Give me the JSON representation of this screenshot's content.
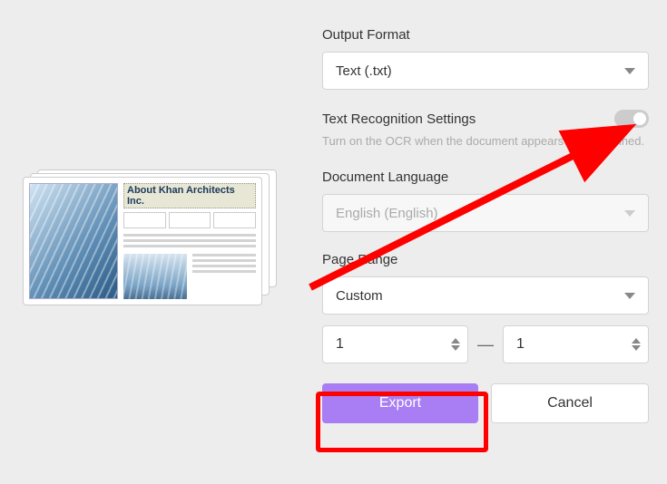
{
  "preview": {
    "doc_title": "About Khan Architects Inc."
  },
  "form": {
    "output_format": {
      "label": "Output Format",
      "value": "Text (.txt)"
    },
    "ocr": {
      "label": "Text Recognition Settings",
      "hint": "Turn on the OCR when the document appears to be scanned.",
      "enabled": false
    },
    "language": {
      "label": "Document Language",
      "value": "English (English)"
    },
    "page_range": {
      "label": "Page Range",
      "mode": "Custom",
      "from": "1",
      "to": "1",
      "separator": "—"
    },
    "actions": {
      "export": "Export",
      "cancel": "Cancel"
    }
  }
}
